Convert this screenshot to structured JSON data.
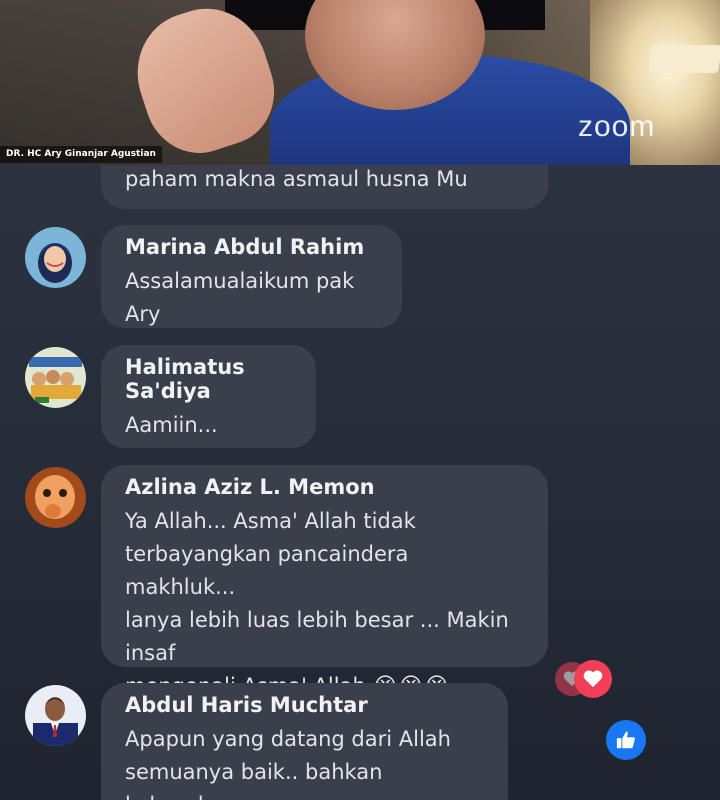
{
  "video": {
    "speaker_name": "DR. HC Ary Ginanjar Agustian",
    "watermark": "zoom"
  },
  "comments": [
    {
      "author": "",
      "text": "paham makna asmaul husna Mu"
    },
    {
      "author": "Marina Abdul Rahim",
      "text": "Assalamualaikum pak Ary"
    },
    {
      "author": "Halimatus Sa'diya",
      "text": "Aamiin..."
    },
    {
      "author": "Azlina Aziz L. Memon",
      "text_lines": [
        "Ya Allah... Asma' Allah tidak",
        "terbayangkan pancaindera makhluk...",
        "lanya lebih luas lebih besar ... Makin insaf",
        "mengenali Asma' Allah"
      ],
      "emoji": "😭😭😭"
    },
    {
      "author": "Abdul Haris Muchtar",
      "text_lines": [
        "Apapun yang datang dari Allah",
        "semuanya baik.. bahkan keburukan"
      ]
    }
  ],
  "reactions": {
    "love_icon": "heart-icon",
    "like_icon": "thumbs-up-icon",
    "colors": {
      "love": "#f33e58",
      "like": "#1877f2"
    }
  }
}
